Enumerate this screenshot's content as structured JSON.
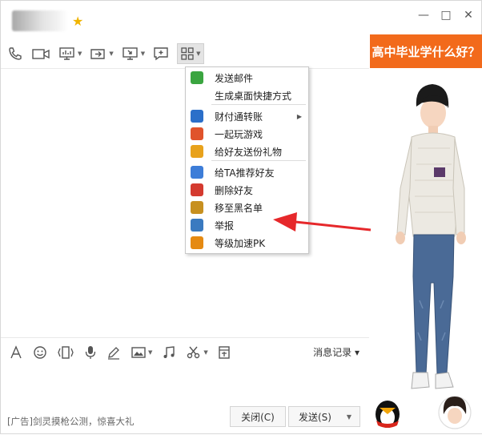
{
  "window": {
    "buttons": {
      "minimize": "—",
      "restore": "□",
      "close": "✕"
    }
  },
  "toolbar": {
    "icons": [
      "phone-icon",
      "video-icon",
      "screen-share-icon",
      "file-transfer-icon",
      "remote-desktop-icon",
      "plus-chat-icon",
      "apps-grid-icon"
    ]
  },
  "menu": {
    "items": [
      {
        "label": "发送邮件",
        "icon": "send-mail-icon",
        "color": "#3aa540"
      },
      {
        "label": "生成桌面快捷方式",
        "icon": "",
        "color": ""
      },
      {
        "label": "财付通转账",
        "icon": "tenpay-icon",
        "color": "#2b6fc9",
        "submenu": true
      },
      {
        "label": "一起玩游戏",
        "icon": "game-icon",
        "color": "#e0532c"
      },
      {
        "label": "给好友送份礼物",
        "icon": "gift-icon",
        "color": "#e8a21c"
      },
      {
        "label": "给TA推荐好友",
        "icon": "recommend-friend-icon",
        "color": "#3d7dd8"
      },
      {
        "label": "删除好友",
        "icon": "delete-friend-icon",
        "color": "#d43a2f"
      },
      {
        "label": "移至黑名单",
        "icon": "blacklist-icon",
        "color": "#c79020"
      },
      {
        "label": "举报",
        "icon": "report-icon",
        "color": "#3a7ac0"
      },
      {
        "label": "等级加速PK",
        "icon": "level-pk-icon",
        "color": "#e58a12"
      }
    ],
    "submenu_arrow": "▶"
  },
  "input_tools": {
    "icons": [
      "font-icon",
      "emoji-icon",
      "shake-icon",
      "voice-icon",
      "pen-icon",
      "image-icon",
      "music-icon",
      "screenshot-icon",
      "red-packet-icon"
    ],
    "history_label": "消息记录 ▾"
  },
  "bottom": {
    "ad_text": "[广告]剑灵摸枪公测，惊喜大礼",
    "close_label": "关闭(C)",
    "send_label": "发送(S)",
    "send_caret": "▼"
  },
  "right_panel": {
    "banner_text": "高中毕业学什么好？"
  },
  "colors": {
    "banner_bg": "#f26a1b",
    "arrow_red": "#e6282b"
  }
}
